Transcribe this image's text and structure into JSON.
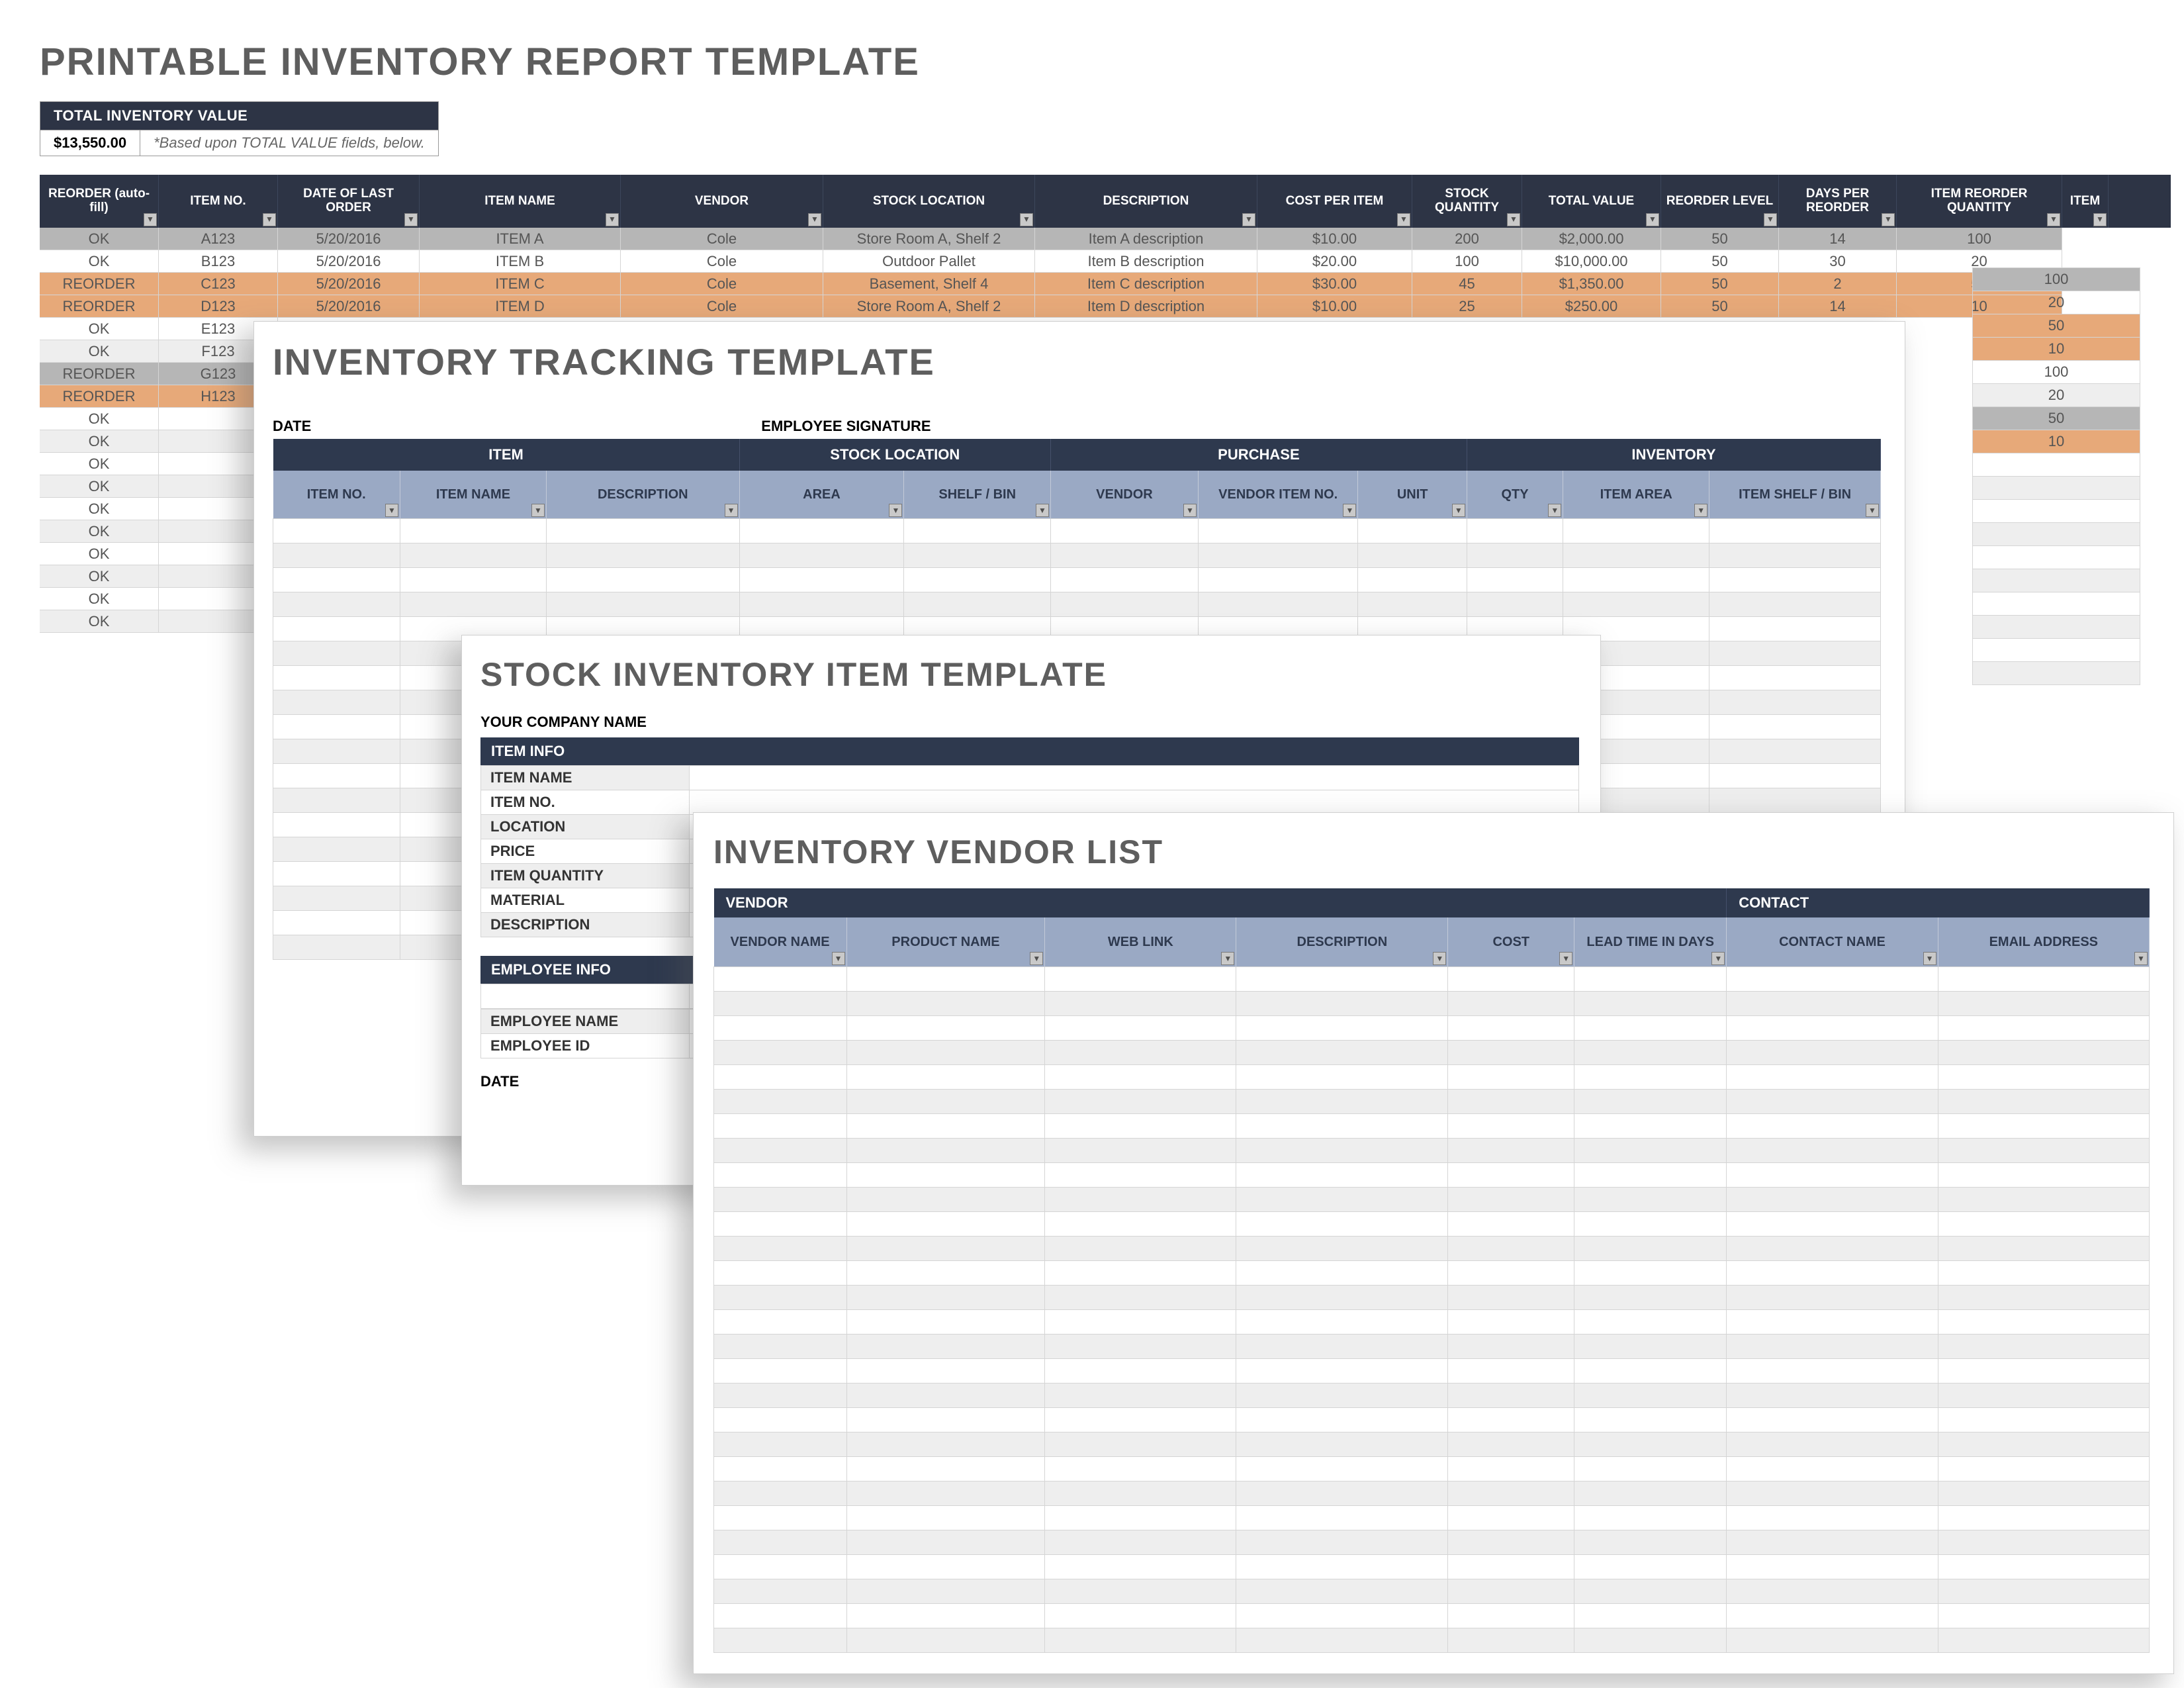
{
  "sheet1": {
    "title": "PRINTABLE INVENTORY REPORT TEMPLATE",
    "total_inventory": {
      "header": "TOTAL INVENTORY VALUE",
      "value": "$13,550.00",
      "note": "*Based upon TOTAL VALUE fields, below."
    },
    "columns": [
      "REORDER (auto-fill)",
      "ITEM NO.",
      "DATE OF LAST ORDER",
      "ITEM NAME",
      "VENDOR",
      "STOCK LOCATION",
      "DESCRIPTION",
      "COST PER ITEM",
      "STOCK QUANTITY",
      "TOTAL VALUE",
      "REORDER LEVEL",
      "DAYS PER REORDER",
      "ITEM REORDER QUANTITY",
      "ITEM"
    ],
    "rows": [
      {
        "status": "OK",
        "state": "sel",
        "item_no": "A123",
        "date": "5/20/2016",
        "name": "ITEM A",
        "vendor": "Cole",
        "loc": "Store Room A, Shelf 2",
        "desc": "Item A description",
        "cost": "$10.00",
        "qty": "200",
        "total": "$2,000.00",
        "re_lvl": "50",
        "days": "14",
        "re_qty": "100"
      },
      {
        "status": "OK",
        "state": "",
        "item_no": "B123",
        "date": "5/20/2016",
        "name": "ITEM B",
        "vendor": "Cole",
        "loc": "Outdoor Pallet",
        "desc": "Item B description",
        "cost": "$20.00",
        "qty": "100",
        "total": "$10,000.00",
        "re_lvl": "50",
        "days": "30",
        "re_qty": "20"
      },
      {
        "status": "REORDER",
        "state": "reo",
        "item_no": "C123",
        "date": "5/20/2016",
        "name": "ITEM C",
        "vendor": "Cole",
        "loc": "Basement, Shelf 4",
        "desc": "Item C description",
        "cost": "$30.00",
        "qty": "45",
        "total": "$1,350.00",
        "re_lvl": "50",
        "days": "2",
        "re_qty": "50"
      },
      {
        "status": "REORDER",
        "state": "reo reo2",
        "item_no": "D123",
        "date": "5/20/2016",
        "name": "ITEM D",
        "vendor": "Cole",
        "loc": "Store Room A, Shelf 2",
        "desc": "Item D description",
        "cost": "$10.00",
        "qty": "25",
        "total": "$250.00",
        "re_lvl": "50",
        "days": "14",
        "re_qty": "10"
      },
      {
        "status": "OK",
        "state": "",
        "item_no": "E123",
        "date": "",
        "name": "",
        "vendor": "",
        "loc": "",
        "desc": "",
        "cost": "",
        "qty": "",
        "total": "",
        "re_lvl": "",
        "days": "",
        "re_qty": "100"
      },
      {
        "status": "OK",
        "state": "alt",
        "item_no": "F123",
        "date": "",
        "name": "",
        "vendor": "",
        "loc": "",
        "desc": "",
        "cost": "",
        "qty": "",
        "total": "",
        "re_lvl": "",
        "days": "",
        "re_qty": "20"
      },
      {
        "status": "REORDER",
        "state": "sel",
        "item_no": "G123",
        "date": "",
        "name": "",
        "vendor": "",
        "loc": "",
        "desc": "",
        "cost": "",
        "qty": "",
        "total": "",
        "re_lvl": "",
        "days": "",
        "re_qty": "50"
      },
      {
        "status": "REORDER",
        "state": "reo",
        "item_no": "H123",
        "date": "",
        "name": "",
        "vendor": "",
        "loc": "",
        "desc": "",
        "cost": "",
        "qty": "",
        "total": "",
        "re_lvl": "",
        "days": "",
        "re_qty": "10"
      },
      {
        "status": "OK",
        "state": "",
        "item_no": "",
        "date": "",
        "name": "",
        "vendor": "",
        "loc": "",
        "desc": "",
        "cost": "",
        "qty": "",
        "total": "",
        "re_lvl": "",
        "days": "",
        "re_qty": ""
      },
      {
        "status": "OK",
        "state": "alt",
        "item_no": "",
        "date": "",
        "name": "",
        "vendor": "",
        "loc": "",
        "desc": "",
        "cost": "",
        "qty": "",
        "total": "",
        "re_lvl": "",
        "days": "",
        "re_qty": ""
      },
      {
        "status": "OK",
        "state": "",
        "item_no": "",
        "date": "",
        "name": "",
        "vendor": "",
        "loc": "",
        "desc": "",
        "cost": "",
        "qty": "",
        "total": "",
        "re_lvl": "",
        "days": "",
        "re_qty": ""
      },
      {
        "status": "OK",
        "state": "alt",
        "item_no": "",
        "date": "",
        "name": "",
        "vendor": "",
        "loc": "",
        "desc": "",
        "cost": "",
        "qty": "",
        "total": "",
        "re_lvl": "",
        "days": "",
        "re_qty": ""
      },
      {
        "status": "OK",
        "state": "",
        "item_no": "",
        "date": "",
        "name": "",
        "vendor": "",
        "loc": "",
        "desc": "",
        "cost": "",
        "qty": "",
        "total": "",
        "re_lvl": "",
        "days": "",
        "re_qty": ""
      },
      {
        "status": "OK",
        "state": "alt",
        "item_no": "",
        "date": "",
        "name": "",
        "vendor": "",
        "loc": "",
        "desc": "",
        "cost": "",
        "qty": "",
        "total": "",
        "re_lvl": "",
        "days": "",
        "re_qty": ""
      },
      {
        "status": "OK",
        "state": "",
        "item_no": "",
        "date": "",
        "name": "",
        "vendor": "",
        "loc": "",
        "desc": "",
        "cost": "",
        "qty": "",
        "total": "",
        "re_lvl": "",
        "days": "",
        "re_qty": ""
      },
      {
        "status": "OK",
        "state": "alt",
        "item_no": "",
        "date": "",
        "name": "",
        "vendor": "",
        "loc": "",
        "desc": "",
        "cost": "",
        "qty": "",
        "total": "",
        "re_lvl": "",
        "days": "",
        "re_qty": ""
      },
      {
        "status": "OK",
        "state": "",
        "item_no": "",
        "date": "",
        "name": "",
        "vendor": "",
        "loc": "",
        "desc": "",
        "cost": "",
        "qty": "",
        "total": "",
        "re_lvl": "",
        "days": "",
        "re_qty": ""
      },
      {
        "status": "OK",
        "state": "alt",
        "item_no": "",
        "date": "",
        "name": "",
        "vendor": "",
        "loc": "",
        "desc": "",
        "cost": "",
        "qty": "",
        "total": "",
        "re_lvl": "",
        "days": "",
        "re_qty": ""
      }
    ]
  },
  "sheet2": {
    "title": "INVENTORY TRACKING TEMPLATE",
    "date_label": "DATE",
    "signature_label": "EMPLOYEE SIGNATURE",
    "groups": [
      "ITEM",
      "STOCK LOCATION",
      "PURCHASE",
      "INVENTORY"
    ],
    "sub": [
      "ITEM NO.",
      "ITEM NAME",
      "DESCRIPTION",
      "AREA",
      "SHELF / BIN",
      "VENDOR",
      "VENDOR ITEM NO.",
      "UNIT",
      "QTY",
      "ITEM AREA",
      "ITEM SHELF / BIN"
    ],
    "blank_rows": 18
  },
  "sheet3": {
    "title": "STOCK INVENTORY ITEM TEMPLATE",
    "company_label": "YOUR COMPANY NAME",
    "item_info": {
      "header": "ITEM INFO",
      "fields": [
        "ITEM NAME",
        "ITEM NO.",
        "LOCATION",
        "PRICE",
        "ITEM QUANTITY",
        "MATERIAL",
        "DESCRIPTION"
      ]
    },
    "employee_info": {
      "header": "EMPLOYEE INFO",
      "fields": [
        "EMPLOYEE NAME",
        "EMPLOYEE ID"
      ]
    },
    "date_label": "DATE"
  },
  "sheet4": {
    "title": "INVENTORY VENDOR LIST",
    "groups": [
      "VENDOR",
      "CONTACT"
    ],
    "sub": [
      "VENDOR NAME",
      "PRODUCT NAME",
      "WEB LINK",
      "DESCRIPTION",
      "COST",
      "LEAD TIME IN DAYS",
      "CONTACT NAME",
      "EMAIL ADDRESS"
    ],
    "blank_rows": 28
  }
}
